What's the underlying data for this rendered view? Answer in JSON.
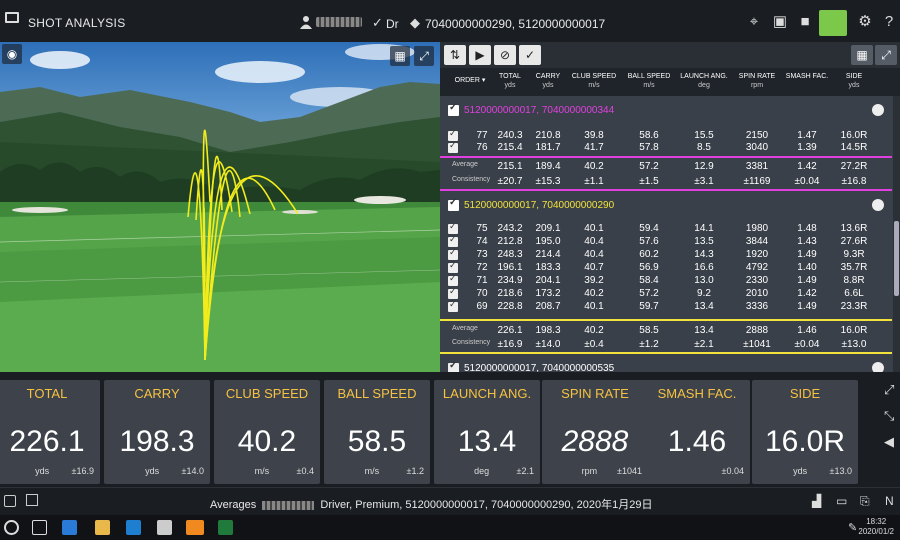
{
  "header": {
    "title": "SHOT ANALYSIS",
    "club": "Dr",
    "session": "7040000000290, 5120000000017"
  },
  "table": {
    "columns": [
      {
        "label": "ORDER",
        "unit": ""
      },
      {
        "label": "TOTAL",
        "unit": "yds"
      },
      {
        "label": "CARRY",
        "unit": "yds"
      },
      {
        "label": "CLUB SPEED",
        "unit": "m/s"
      },
      {
        "label": "BALL SPEED",
        "unit": "m/s"
      },
      {
        "label": "LAUNCH ANG.",
        "unit": "deg"
      },
      {
        "label": "SPIN RATE",
        "unit": "rpm"
      },
      {
        "label": "SMASH FAC.",
        "unit": ""
      },
      {
        "label": "SIDE",
        "unit": "yds"
      }
    ],
    "group1": {
      "title": "5120000000017, 7040000000344",
      "rows": [
        [
          "77",
          "240.3",
          "210.8",
          "39.8",
          "58.6",
          "15.5",
          "2150",
          "1.47",
          "16.0R"
        ],
        [
          "76",
          "215.4",
          "181.7",
          "41.7",
          "57.8",
          "8.5",
          "3040",
          "1.39",
          "14.5R"
        ]
      ],
      "average": [
        "Average",
        "215.1",
        "189.4",
        "40.2",
        "57.2",
        "12.9",
        "3381",
        "1.42",
        "27.2R"
      ],
      "consistency": [
        "Consistency",
        "±20.7",
        "±15.3",
        "±1.1",
        "±1.5",
        "±3.1",
        "±1169",
        "±0.04",
        "±16.8"
      ]
    },
    "group2": {
      "title": "5120000000017, 7040000000290",
      "rows": [
        [
          "75",
          "243.2",
          "209.1",
          "40.1",
          "59.4",
          "14.1",
          "1980",
          "1.48",
          "13.6R"
        ],
        [
          "74",
          "212.8",
          "195.0",
          "40.4",
          "57.6",
          "13.5",
          "3844",
          "1.43",
          "27.6R"
        ],
        [
          "73",
          "248.3",
          "214.4",
          "40.4",
          "60.2",
          "14.3",
          "1920",
          "1.49",
          "9.3R"
        ],
        [
          "72",
          "196.1",
          "183.3",
          "40.7",
          "56.9",
          "16.6",
          "4792",
          "1.40",
          "35.7R"
        ],
        [
          "71",
          "234.9",
          "204.1",
          "39.2",
          "58.4",
          "13.0",
          "2330",
          "1.49",
          "8.8R"
        ],
        [
          "70",
          "218.6",
          "173.2",
          "40.2",
          "57.2",
          "9.2",
          "2010",
          "1.42",
          "6.6L"
        ],
        [
          "69",
          "228.8",
          "208.7",
          "40.1",
          "59.7",
          "13.4",
          "3336",
          "1.49",
          "23.3R"
        ]
      ],
      "average": [
        "Average",
        "226.1",
        "198.3",
        "40.2",
        "58.5",
        "13.4",
        "2888",
        "1.46",
        "16.0R"
      ],
      "consistency": [
        "Consistency",
        "±16.9",
        "±14.0",
        "±0.4",
        "±1.2",
        "±2.1",
        "±1041",
        "±0.04",
        "±13.0"
      ]
    },
    "group3": {
      "title": "5120000000017, 7040000000535"
    }
  },
  "metrics": [
    {
      "label": "TOTAL",
      "value": "226.1",
      "unit": "yds",
      "dev": "±16.9"
    },
    {
      "label": "CARRY",
      "value": "198.3",
      "unit": "yds",
      "dev": "±14.0"
    },
    {
      "label": "CLUB SPEED",
      "value": "40.2",
      "unit": "m/s",
      "dev": "±0.4"
    },
    {
      "label": "BALL SPEED",
      "value": "58.5",
      "unit": "m/s",
      "dev": "±1.2"
    },
    {
      "label": "LAUNCH ANG.",
      "value": "13.4",
      "unit": "deg",
      "dev": "±2.1"
    },
    {
      "label": "SPIN RATE",
      "value": "2888",
      "unit": "rpm",
      "dev": "±1041"
    },
    {
      "label": "SMASH FAC.",
      "value": "1.46",
      "unit": "",
      "dev": "±0.04"
    },
    {
      "label": "SIDE",
      "value": "16.0R",
      "unit": "yds",
      "dev": "±13.0"
    }
  ],
  "averages_bar": {
    "prefix": "Averages",
    "text": "Driver, Premium, 5120000000017, 7040000000290, 2020年1月29日",
    "right_label": "N"
  },
  "taskbar": {
    "time": "18:32",
    "date": "2020/01/2"
  },
  "colors": {
    "accent_yellow": "#f5c242",
    "group1_magenta": "#e040e0",
    "group2_yellow": "#f2e23c",
    "green_button": "#7bc84a"
  }
}
